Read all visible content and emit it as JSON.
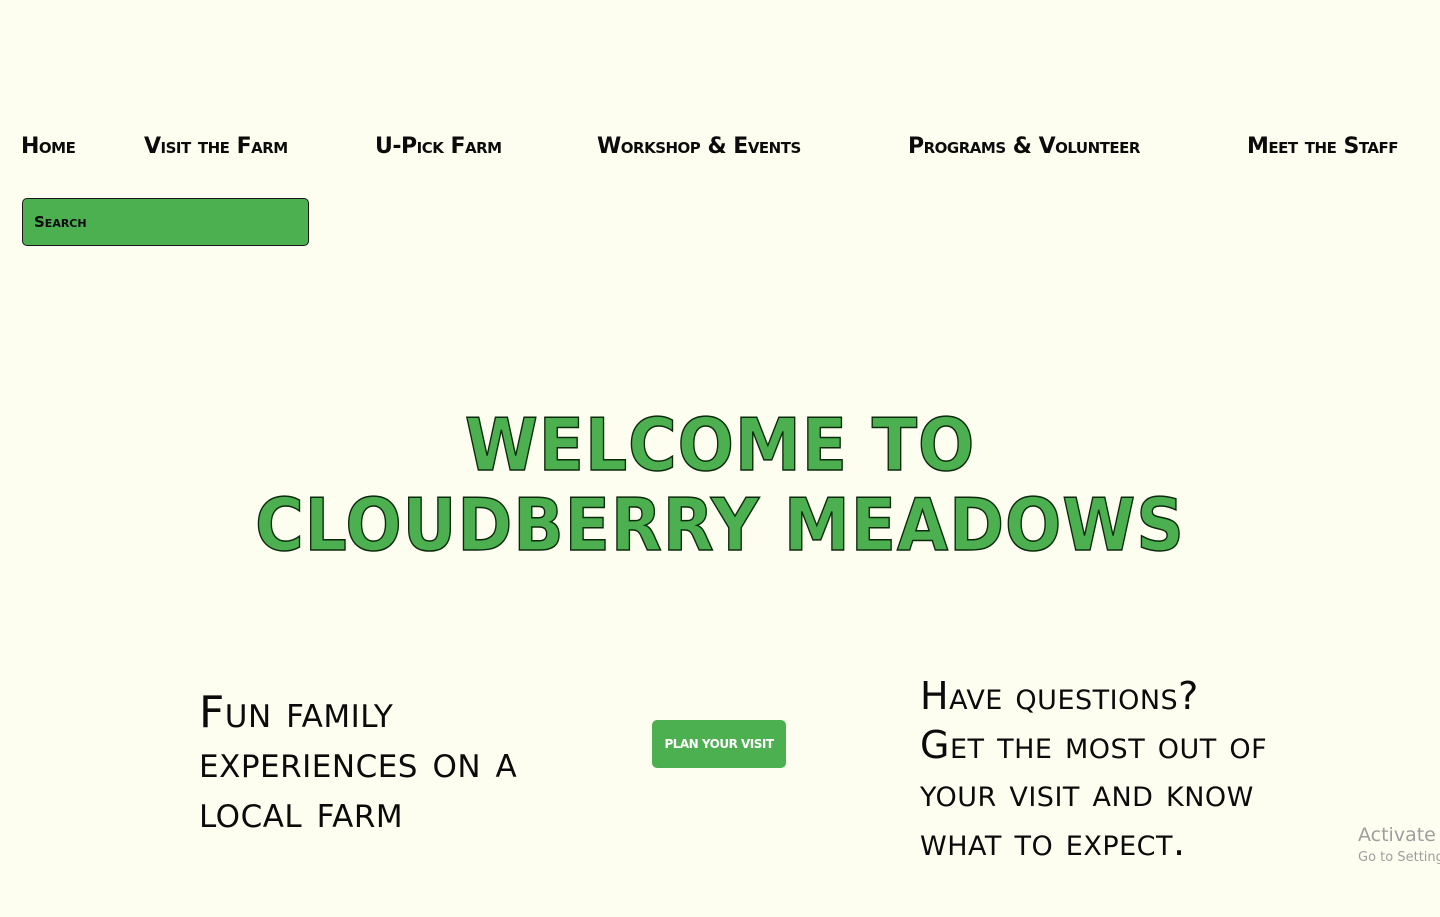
{
  "nav": {
    "items": [
      {
        "label": "Home"
      },
      {
        "label": "Visit the Farm"
      },
      {
        "label": "U-Pick Farm"
      },
      {
        "label": "Workshop & Events"
      },
      {
        "label": "Programs & Volunteer"
      },
      {
        "label": "Meet the Staff"
      }
    ]
  },
  "search": {
    "placeholder": "Search"
  },
  "hero": {
    "title": "Welcome to Cloudberry Meadows"
  },
  "content": {
    "tagline": "Fun family experiences on a local farm",
    "cta_label": "Plan your visit",
    "questions_lines": [
      "Have questions?",
      "Get the most out of",
      "your visit and know",
      "what to expect."
    ]
  },
  "watermark": {
    "title": "Activate Windows",
    "subtitle": "Go to Settings to activate Windows."
  },
  "colors": {
    "background": "#fefef0",
    "accent_green": "#4caf50",
    "text": "#0b0b0b",
    "watermark": "#9e9e9e"
  }
}
